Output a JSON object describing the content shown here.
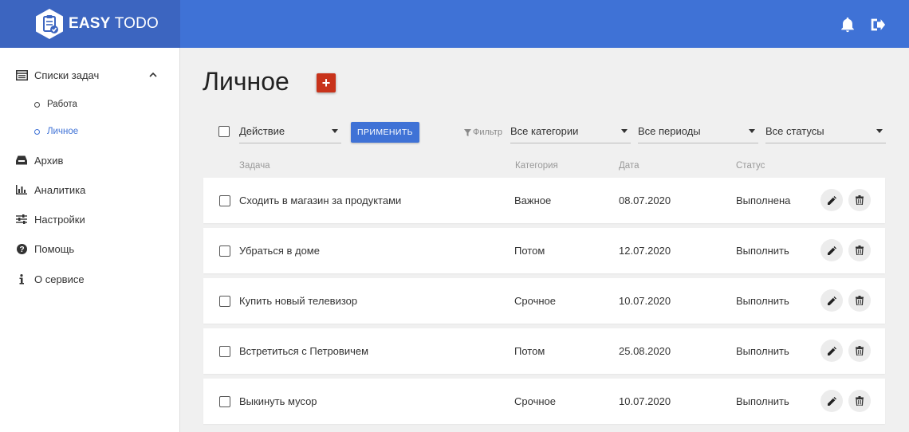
{
  "app": {
    "logo_bold": "EASY",
    "logo_light": "TODO"
  },
  "header": {
    "icons": [
      "bell-icon",
      "logout-icon"
    ]
  },
  "sidebar": {
    "items": [
      {
        "label": "Списки задач",
        "icon": "list-icon",
        "expanded": true
      },
      {
        "label": "Архив",
        "icon": "inbox-icon"
      },
      {
        "label": "Аналитика",
        "icon": "bar-chart-icon"
      },
      {
        "label": "Настройки",
        "icon": "sliders-icon"
      },
      {
        "label": "Помощь",
        "icon": "question-icon"
      },
      {
        "label": "О сервисе",
        "icon": "info-icon"
      }
    ],
    "subitems": [
      {
        "label": "Работа",
        "active": false
      },
      {
        "label": "Личное",
        "active": true
      }
    ]
  },
  "main": {
    "title": "Личное",
    "add_label": "+",
    "action_select": "Действие",
    "apply_label": "ПРИМЕНИТЬ",
    "filter_label": "Фильтр",
    "filters": {
      "category": "Все категории",
      "period": "Все периоды",
      "status": "Все статусы"
    },
    "columns": {
      "task": "Задача",
      "category": "Категория",
      "date": "Дата",
      "status": "Статус"
    },
    "rows": [
      {
        "task": "Сходить в магазин за продуктами",
        "category": "Важное",
        "date": "08.07.2020",
        "status": "Выполнена"
      },
      {
        "task": "Убраться в доме",
        "category": "Потом",
        "date": "12.07.2020",
        "status": "Выполнить"
      },
      {
        "task": "Купить новый телевизор",
        "category": "Срочное",
        "date": "10.07.2020",
        "status": "Выполнить"
      },
      {
        "task": "Встретиться с Петровичем",
        "category": "Потом",
        "date": "25.08.2020",
        "status": "Выполнить"
      },
      {
        "task": "Выкинуть мусор",
        "category": "Срочное",
        "date": "10.07.2020",
        "status": "Выполнить"
      }
    ]
  },
  "colors": {
    "header": "#3f72d6",
    "logo_bg": "#3c65c0",
    "add_button": "#c8331b",
    "active_link": "#3f72d6"
  }
}
